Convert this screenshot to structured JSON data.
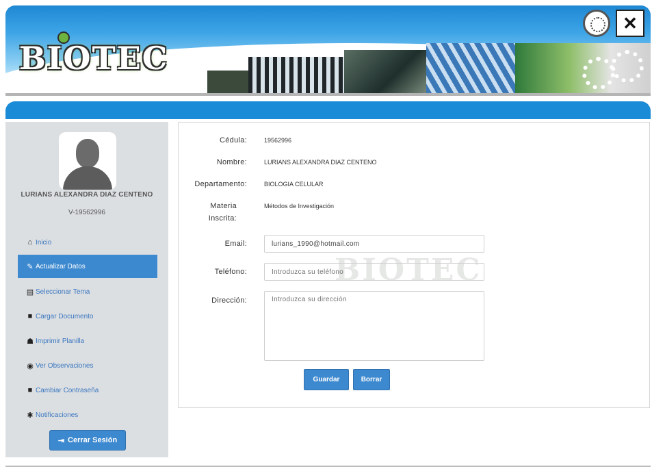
{
  "header": {
    "logo_text": "BIOTEC"
  },
  "sidebar": {
    "user_name": "LURIANS ALEXANDRA DIAZ CENTENO",
    "user_id": "V-19562996",
    "items": [
      {
        "label": "Inicio",
        "icon": "home-icon",
        "glyph": "⌂"
      },
      {
        "label": "Actualizar Datos",
        "icon": "edit-icon",
        "glyph": "✎"
      },
      {
        "label": "Seleccionar Tema",
        "icon": "list-icon",
        "glyph": "▤"
      },
      {
        "label": "Cargar Documento",
        "icon": "book-icon",
        "glyph": "■"
      },
      {
        "label": "Imprimir Planilla",
        "icon": "users-icon",
        "glyph": "☗"
      },
      {
        "label": "Ver Observaciones",
        "icon": "eye-icon",
        "glyph": "◉"
      },
      {
        "label": "Cambiar Contraseña",
        "icon": "lock-icon",
        "glyph": "■"
      },
      {
        "label": "Notificaciones",
        "icon": "asterisk-icon",
        "glyph": "✱"
      }
    ],
    "logout_label": "Cerrar Sesión"
  },
  "form": {
    "cedula_label": "Cédula:",
    "cedula_value": "19562996",
    "nombre_label": "Nombre:",
    "nombre_value": "LURIANS ALEXANDRA DIAZ CENTENO",
    "departamento_label": "Departamento:",
    "departamento_value": "BIOLOGIA CELULAR",
    "materia_label_1": "Materia",
    "materia_label_2": "Inscrita:",
    "materia_value": "Métodos de Investigación",
    "email_label": "Email:",
    "email_value": "lurians_1990@hotmail.com",
    "telefono_label": "Teléfono:",
    "telefono_placeholder": "Introduzca su teléfono",
    "direccion_label": "Dirección:",
    "direccion_placeholder": "Introduzca su dirección",
    "save_label": "Guardar",
    "clear_label": "Borrar",
    "watermark_text": "BIOTEC"
  },
  "colors": {
    "primary": "#3d89cf",
    "band": "#1a8bd6",
    "sidebar_bg": "#dcdfe2",
    "link": "#3a77bf"
  }
}
